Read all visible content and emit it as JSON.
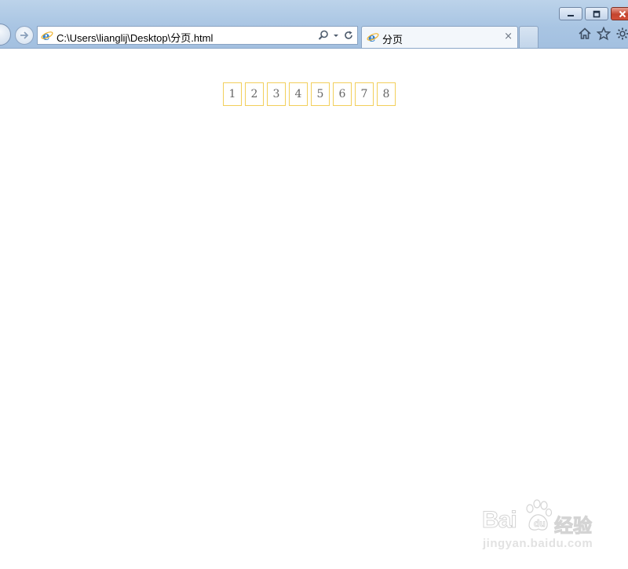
{
  "browser": {
    "address": "C:\\Users\\lianglij\\Desktop\\分页.html",
    "tab_title": "分页",
    "tab_close": "×",
    "window_controls": {
      "minimize": "minimize-icon",
      "maximize": "maximize-icon",
      "close": "close-icon"
    },
    "toolbar_icons": [
      "home-icon",
      "favorites-star-icon",
      "settings-gear-icon"
    ]
  },
  "pagination": {
    "pages": [
      "1",
      "2",
      "3",
      "4",
      "5",
      "6",
      "7",
      "8"
    ],
    "border_color": "#f2cf5b",
    "text_color": "#666666"
  },
  "watermark": {
    "brand": "Bai",
    "brand_suffix": "经验",
    "url": "jingyan.baidu.com"
  }
}
